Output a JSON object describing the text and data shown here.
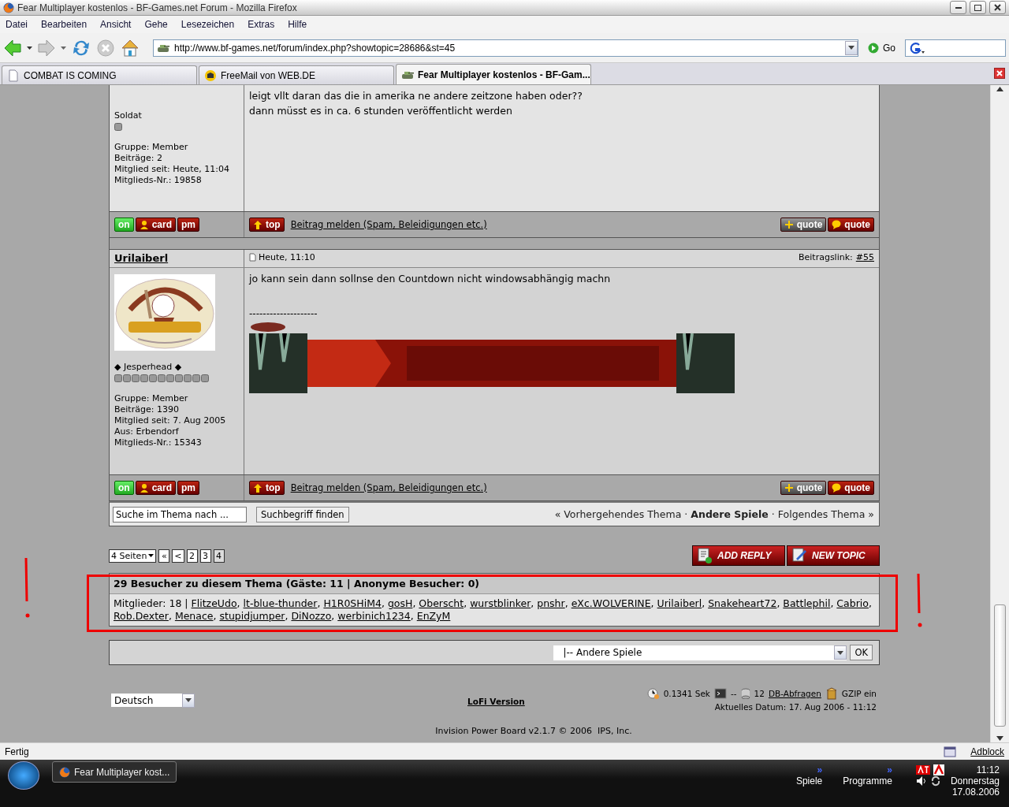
{
  "window": {
    "title": "Fear Multiplayer kostenlos - BF-Games.net Forum - Mozilla Firefox"
  },
  "menu": [
    "Datei",
    "Bearbeiten",
    "Ansicht",
    "Gehe",
    "Lesezeichen",
    "Extras",
    "Hilfe"
  ],
  "address": {
    "url": "http://www.bf-games.net/forum/index.php?showtopic=28686&st=45",
    "go": "Go"
  },
  "tabs": [
    {
      "label": "COMBAT IS COMING",
      "selected": false,
      "kind": "page"
    },
    {
      "label": "FreeMail von WEB.DE",
      "selected": false,
      "kind": "mail"
    },
    {
      "label": "Fear Multiplayer kostenlos - BF-Gam...",
      "selected": true,
      "kind": "tank"
    }
  ],
  "posts": [
    {
      "rank": "Soldat",
      "rank_pips": [
        {
          "filled": true
        }
      ],
      "details": [
        "Gruppe: Member",
        "Beiträge: 2",
        "Mitglied seit: Heute, 11:04",
        "Mitglieds-Nr.: 19858"
      ],
      "body": [
        "leigt vllt daran das die in amerika ne andere zeitzone haben oder??",
        "dann müsst es in ca. 6 stunden veröffentlicht werden"
      ],
      "buttons": {
        "left": [
          {
            "label": "on",
            "kind": "online"
          },
          {
            "label": "card",
            "kind": "card"
          },
          {
            "label": "pm",
            "kind": "pm"
          }
        ],
        "top": {
          "label": "top",
          "kind": "top"
        },
        "right": [
          {
            "label": "quote",
            "kind": "addquote"
          },
          {
            "label": "quote",
            "kind": "quote"
          }
        ]
      },
      "report": "Beitrag melden (Spam, Beleidigungen etc.)"
    },
    {
      "author": "Urilaiberl",
      "date": "Heute, 11:10",
      "link_label": "Beitragslink:",
      "link": "#55",
      "avatar": {
        "kind": "picture"
      },
      "rank": "◆ Jesperhead ◆",
      "rank_pips": [
        {
          "filled": true
        },
        {
          "filled": true
        },
        {
          "filled": true
        },
        {
          "filled": true
        },
        {
          "filled": true
        },
        {
          "filled": true
        },
        {
          "filled": true
        },
        {
          "filled": true
        },
        {
          "filled": true
        },
        {
          "filled": true
        },
        {
          "filled": true
        }
      ],
      "details": [
        "Gruppe: Member",
        "Beiträge: 1390",
        "Mitglied seit: 7. Aug 2005",
        "Aus: Erbendorf",
        "Mitglieds-Nr.: 15343"
      ],
      "body": [
        "jo kann sein dann sollnse den Countdown nicht windowsabhängig machn"
      ],
      "signature_rule": "--------------------",
      "signature": {
        "kind": "picture"
      },
      "buttons": {
        "left": [
          {
            "label": "on",
            "kind": "online"
          },
          {
            "label": "card",
            "kind": "card"
          },
          {
            "label": "pm",
            "kind": "pm"
          }
        ],
        "top": {
          "label": "top",
          "kind": "top"
        },
        "right": [
          {
            "label": "quote",
            "kind": "addquote"
          },
          {
            "label": "quote",
            "kind": "quote"
          }
        ]
      },
      "report": "Beitrag melden (Spam, Beleidigungen etc.)"
    }
  ],
  "topic_search": {
    "value": "Suche im Thema nach ...",
    "button": "Suchbegriff finden"
  },
  "topic_nav": [
    {
      "text": "« Vorhergehendes Thema",
      "kind": "link"
    },
    {
      "text": "·",
      "kind": "sep"
    },
    {
      "text": "Andere Spiele",
      "kind": "bold"
    },
    {
      "text": "·",
      "kind": "sep"
    },
    {
      "text": "Folgendes Thema »",
      "kind": "link"
    }
  ],
  "pagination": {
    "pages_label": "4 Seiten",
    "items": [
      {
        "label": "«",
        "selected": false
      },
      {
        "label": "<",
        "selected": false
      },
      {
        "label": "2",
        "selected": false
      },
      {
        "label": "3",
        "selected": false
      },
      {
        "label": "4",
        "selected": true
      }
    ]
  },
  "actions": [
    {
      "label": "ADD REPLY",
      "kind": "reply"
    },
    {
      "label": "NEW TOPIC",
      "kind": "topic"
    }
  ],
  "visitors": {
    "title": "29 Besucher zu diesem Thema (Gäste: 11 | Anonyme Besucher: 0)",
    "members_label": "Mitglieder: 18 |",
    "separator": ",",
    "members": [
      "FlitzeUdo",
      "lt-blue-thunder",
      "H1R0SHiM4",
      "gosH",
      "Oberscht",
      "wurstblinker",
      "pnshr",
      "eXc.WOLVERINE",
      "Urilaiberl",
      "Snakeheart72",
      "Battlephil",
      "Cabrio",
      "Rob.Dexter",
      "Menace",
      "stupidjumper",
      "DiNozzo",
      "werbinich1234",
      "EnZyM"
    ]
  },
  "jump": {
    "value": "|-- Andere Spiele",
    "button": "OK"
  },
  "footer": {
    "language": "Deutsch",
    "lofi": "LoFi Version",
    "time": "0.1341 Sek",
    "load": "--",
    "queries": "12",
    "queries_link": "DB-Abfragen",
    "gzip": "GZIP ein",
    "date": "Aktuelles Datum: 17. Aug 2006 - 11:12",
    "copyright": "Invision Power Board v2.1.7 © 2006  IPS, Inc."
  },
  "status_bar": {
    "text": "Fertig",
    "adblock": "Adblock"
  },
  "taskbar": {
    "task": "Fear Multiplayer kost...",
    "chevron": "»",
    "toolbars": [
      "Spiele",
      "Programme"
    ],
    "time": "11:12",
    "day": "Donnerstag",
    "date": "17.08.2006"
  }
}
